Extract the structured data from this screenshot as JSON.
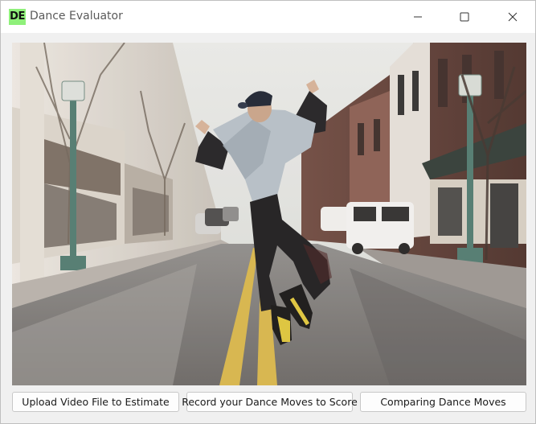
{
  "window": {
    "icon_text": "DE",
    "title": "Dance Evaluator"
  },
  "controls": {
    "minimize_icon": "minimize-icon",
    "maximize_icon": "maximize-icon",
    "close_icon": "close-icon"
  },
  "buttons": {
    "upload_label": "Upload Video File to Estimate",
    "record_label": "Record your Dance Moves to Score",
    "compare_label": "Comparing Dance Moves"
  },
  "colors": {
    "icon_bg": "#8ff07a",
    "window_bg": "#f0f0f0",
    "titlebar_bg": "#ffffff"
  }
}
